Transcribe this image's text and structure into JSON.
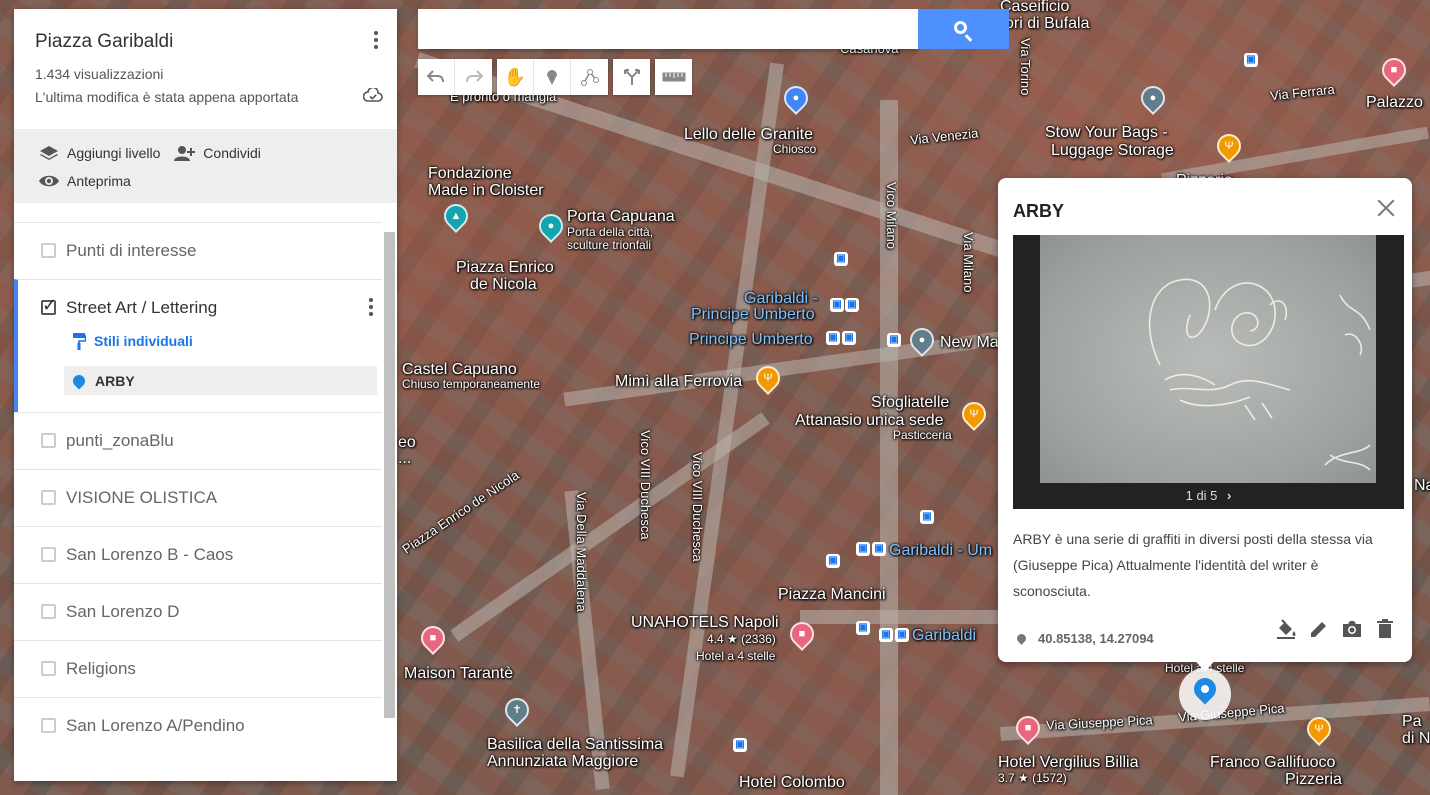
{
  "panel": {
    "map_title": "Piazza Garibaldi",
    "views": "1.434 visualizzazioni",
    "last_edit": "L'ultima modifica è stata appena apportata",
    "add_layer": "Aggiungi livello",
    "share": "Condividi",
    "preview": "Anteprima"
  },
  "layers": [
    {
      "name": "Punti di interesse",
      "checked": false
    },
    {
      "name": "Street Art / Lettering",
      "checked": true,
      "style_link": "Stili individuali",
      "feature": "ARBY"
    },
    {
      "name": "punti_zonaBlu",
      "checked": false
    },
    {
      "name": "VISIONE OLISTICA",
      "checked": false
    },
    {
      "name": "San Lorenzo B - Caos",
      "checked": false
    },
    {
      "name": "San Lorenzo D",
      "checked": false
    },
    {
      "name": "Religions",
      "checked": false
    },
    {
      "name": "San Lorenzo A/Pendino",
      "checked": false
    }
  ],
  "search": {
    "placeholder": ""
  },
  "info": {
    "title": "ARBY",
    "photo_counter": "1 di 5",
    "description": "ARBY è una serie di graffiti in diversi posti della stessa via (Giuseppe Pica) Attualmente l'identità del writer è sconosciuta.",
    "coords": "40.85138, 14.27094"
  },
  "map_labels": {
    "caseificio": "Caseificio",
    "bufala": "ori di Bufala",
    "casanova": "Casanova",
    "pronto": "È pronto o mangia",
    "granite": "Lello delle Granite",
    "chiosco": "Chiosco",
    "fondazione1": "Fondazione",
    "fondazione2": "Made in Cloister",
    "porta": "Porta Capuana",
    "porta_sub1": "Porta della città,",
    "porta_sub2": "sculture trionfali",
    "enrico1": "Piazza Enrico",
    "enrico2": "de Nicola",
    "garibaldi1": "Garibaldi -",
    "umberto1": "Principe Umberto",
    "umberto2": "Principe Umberto",
    "castel": "Castel Capuano",
    "castel_sub": "Chiuso temporaneamente",
    "mimi": "Mimì alla Ferrovia",
    "sfogliatelle": "Sfogliatelle",
    "attanasio": "Attanasio unica sede",
    "pasticceria": "Pasticceria",
    "venezia": "Via Venezia",
    "stow1": "Stow Your Bags -",
    "stow2": "Luggage Storage",
    "ferrara": "Via Ferrara",
    "palazzo": "Palazzo",
    "torino": "Via Torino",
    "vico_milano": "Vico Milano",
    "via_milano": "Via Milano",
    "new_ma": "New Ma",
    "mancini": "Piazza Mancini",
    "unahotels": "UNAHOTELS Napoli",
    "una_rating": "4.4 ★ (2336)",
    "una_sub": "Hotel a 4 stelle",
    "garibaldi2": "Garibaldi",
    "garibaldi_um": "Garibaldi - Um",
    "maison": "Maison Tarantè",
    "basilica1": "Basilica della Santissima",
    "basilica2": "Annunziata Maggiore",
    "colombo": "Hotel Colombo",
    "pica1": "Via Giuseppe Pica",
    "pica2": "Via Giuseppe Pica",
    "vergilius": "Hotel Vergilius Billia",
    "verg_rating": "3.7 ★ (1572)",
    "franco1": "Franco Gallifuoco",
    "franco2": "Pizzeria",
    "enrico_nicola": "Piazza Enrico de Nicola",
    "maddalena": "Via Della Maddalena",
    "duchesca1": "Vico VIII Duchesca",
    "duchesca2": "Vico VIII Duchesca",
    "hotel_stelle": "Hotel a 4 stelle",
    "pizzerie": "Pizzerie",
    "pa": "Pa",
    "di_n": "di N",
    "na": "Na",
    "eo": "eo",
    "dots": "..."
  },
  "colors": {
    "accent": "#4285f4",
    "search_button": "#4d90fe",
    "marker": "#1e88e5"
  }
}
